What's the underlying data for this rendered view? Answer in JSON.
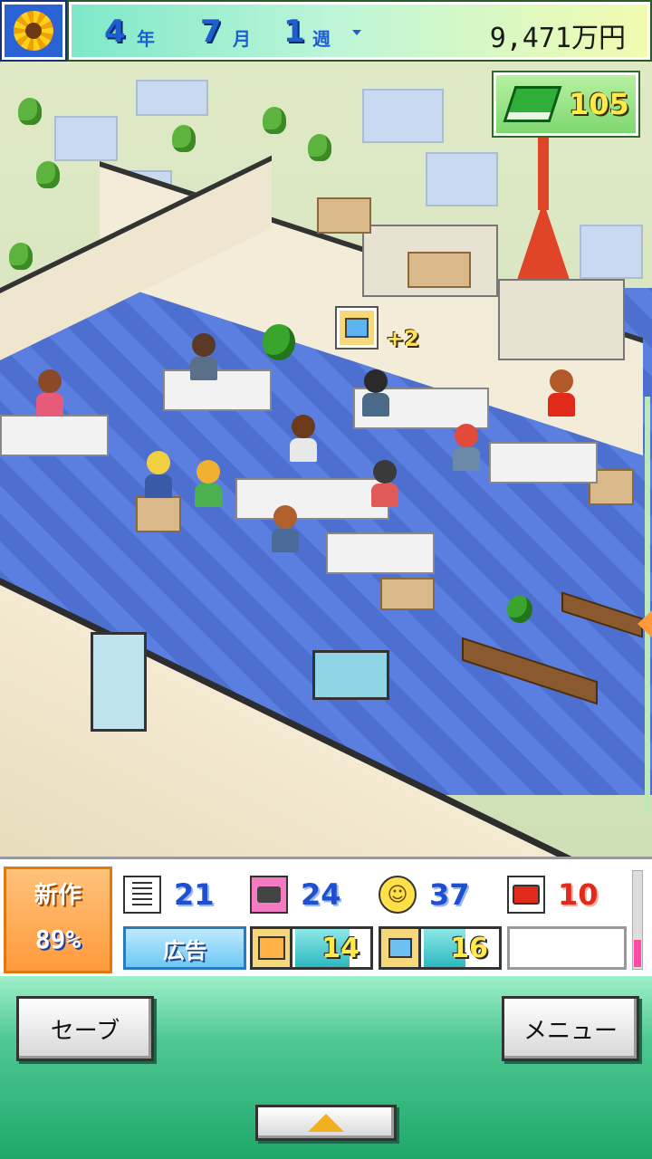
{
  "header": {
    "year": "4",
    "year_unit": "年",
    "month": "7",
    "month_unit": "月",
    "week": "1",
    "week_unit": "週",
    "money": "9,471万円",
    "season_icon": "sunflower-icon"
  },
  "scene": {
    "books_count": "105",
    "book_icon": "money-book-icon",
    "event_popup": "+2",
    "event_icon": "computer-icon"
  },
  "status": {
    "new_work_label": "新作",
    "new_work_percent": "89%",
    "stats": [
      {
        "icon": "document-icon",
        "value": "21",
        "color": "#1d4fd0"
      },
      {
        "icon": "photo-icon",
        "value": "24",
        "color": "#1d4fd0"
      },
      {
        "icon": "smile-icon",
        "value": "37",
        "color": "#1d4fd0"
      },
      {
        "icon": "printer-icon",
        "value": "10",
        "color": "#e22a1a"
      }
    ],
    "ad_button": "広告",
    "meters": [
      {
        "icon": "shop-icon",
        "value": "14",
        "fill": 0.72
      },
      {
        "icon": "computer-icon",
        "value": "16",
        "fill": 0.55
      }
    ],
    "scroll_thumb_fraction": 0.3
  },
  "controls": {
    "save_label": "セーブ",
    "menu_label": "メニュー",
    "up_icon": "triangle-up-icon"
  },
  "colors": {
    "accent_orange": "#ff9a3c",
    "stat_blue": "#1d4fd0",
    "stat_red": "#e22a1a",
    "controls_green": "#1ea86a"
  }
}
